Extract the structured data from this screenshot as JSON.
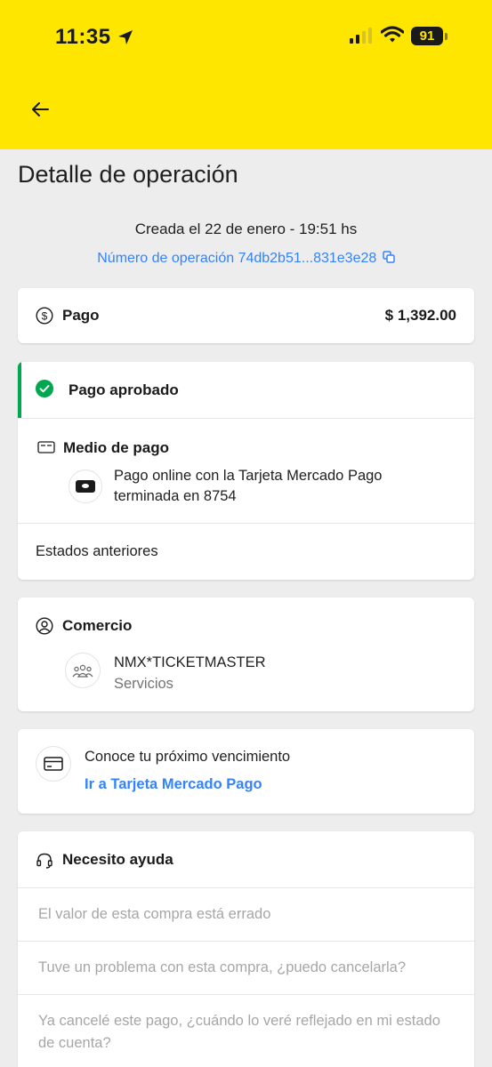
{
  "status_bar": {
    "time": "11:35",
    "battery": "91"
  },
  "page": {
    "title": "Detalle de operación"
  },
  "operation": {
    "created": "Creada el 22 de enero - 19:51 hs",
    "number": "Número de operación 74db2b51...831e3e28"
  },
  "payment": {
    "label": "Pago",
    "amount": "$ 1,392.00"
  },
  "status": {
    "approved_label": "Pago aprobado",
    "approved_color": "#00a650",
    "method_title": "Medio de pago",
    "method_description": "Pago online con la Tarjeta Mercado Pago terminada en 8754",
    "previous_states": "Estados anteriores"
  },
  "merchant": {
    "title": "Comercio",
    "name": "NMX*TICKETMASTER",
    "category": "Servicios"
  },
  "due_date": {
    "title": "Conoce tu próximo vencimiento",
    "link": "Ir a Tarjeta Mercado Pago"
  },
  "help": {
    "title": "Necesito ayuda",
    "questions": [
      "El valor de esta compra está errado",
      "Tuve un problema con esta compra, ¿puedo cancelarla?",
      "Ya cancelé este pago, ¿cuándo lo veré reflejado en mi estado de cuenta?"
    ]
  },
  "colors": {
    "header": "#ffe600",
    "link": "#3483fa",
    "background": "#ededed"
  }
}
